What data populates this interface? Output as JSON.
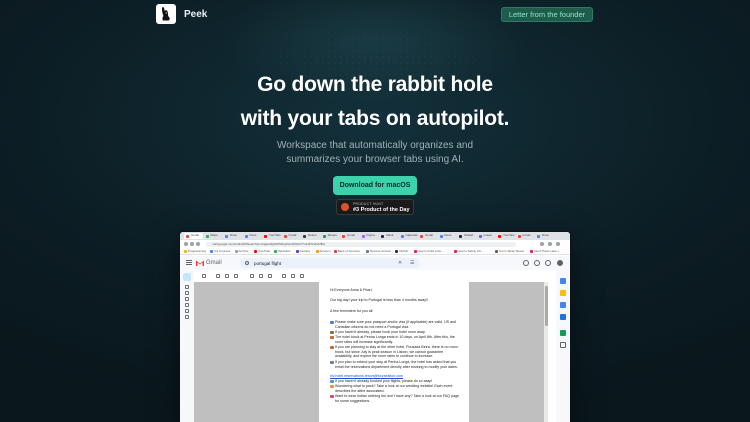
{
  "header": {
    "brand": "Peek",
    "founder_button": "Letter from the founder"
  },
  "hero": {
    "title_line1": "Go down the rabbit hole",
    "title_line2": "with your tabs on autopilot.",
    "subtitle_line1": "Workspace that automatically organizes and",
    "subtitle_line2": "summarizes your browser tabs using AI.",
    "cta": "Download for macOS",
    "badge_small": "PRODUCT HUNT",
    "badge_big": "#3 Product of the Day"
  },
  "colors": {
    "background": "#0c1d24",
    "accent": "#3ed2ac",
    "founder_bg": "#1e5c4c"
  },
  "screenshot": {
    "address": "mail.google.com/mail/u/0/#search/portugal+flight/FMfcgzGtvWQbLVTmHtNVsbxbfBLi",
    "tabs": [
      {
        "label": "Gmail",
        "color": "#ea4335"
      },
      {
        "label": "Maps",
        "color": "#34a853"
      },
      {
        "label": "Drive",
        "color": "#4285f4"
      },
      {
        "label": "Docs",
        "color": "#4285f4"
      },
      {
        "label": "YouTube",
        "color": "#ff0000"
      },
      {
        "label": "Gmail",
        "color": "#ea4335"
      },
      {
        "label": "Notion",
        "color": "#333333"
      },
      {
        "label": "Sheets",
        "color": "#0f9d58"
      },
      {
        "label": "Gmail",
        "color": "#ea4335"
      },
      {
        "label": "Figma",
        "color": "#a259ff"
      },
      {
        "label": "Slack",
        "color": "#4a154b"
      },
      {
        "label": "Calendar",
        "color": "#4285f4"
      },
      {
        "label": "Gmail",
        "color": "#ea4335"
      },
      {
        "label": "Docs",
        "color": "#4285f4"
      },
      {
        "label": "GitHub",
        "color": "#24292e"
      },
      {
        "label": "Linear",
        "color": "#5e6ad2"
      },
      {
        "label": "YouTube",
        "color": "#ff0000"
      },
      {
        "label": "Gmail",
        "color": "#ea4335"
      },
      {
        "label": "Drive",
        "color": "#4285f4"
      }
    ],
    "bookmarks": [
      "Programming",
      "CS Courses",
      "Archive",
      "YouTube",
      "Websites",
      "Fantasy",
      "Amazon",
      "Bank of America",
      "Remote Access",
      "Github",
      "How to build a Ro...",
      "How to Safely Lift...",
      "Tom's Meter Reset",
      "Don't Panic Here i..."
    ],
    "gmail_label": "Gmail",
    "search_query": "portugal flight",
    "email_lines": [
      "Hi Everyone Anna & Pearl,",
      "Our big day! your trip to Portugal is less than 4 months away!!",
      "A few reminders for you all:",
      "Please make sure your passport and/or visa (if applicable) are valid. US and Canadian citizens do not need a Portugal visa.",
      "If you haven't already, please book your hotel room asap.",
      "The hotel block at Penha Longa ends in 10 days, on April 8th. After this, the room rates will increase significantly.",
      "If you are planning to stay at the other hotel, Pousada Beira, there is no room block, but since July is peak season in Lisbon, we cannot guarantee availability, and expect the room rates to continue to increase.",
      "If you plan to extend your stay at Penha Longa, the hotel has asked that you email the reservations department directly after booking to modify your dates:",
      "hiv.hotel.reservations.resort@fourseaiton.com",
      "If you haven't already booked your flights, please do so asap!",
      "Wondering what to pack? Take a look at our wedding website! Each event describes the attire associated.",
      "Want to wear Indian clothing but don't have any? Take a look at our FAQ page for some suggestions."
    ]
  }
}
